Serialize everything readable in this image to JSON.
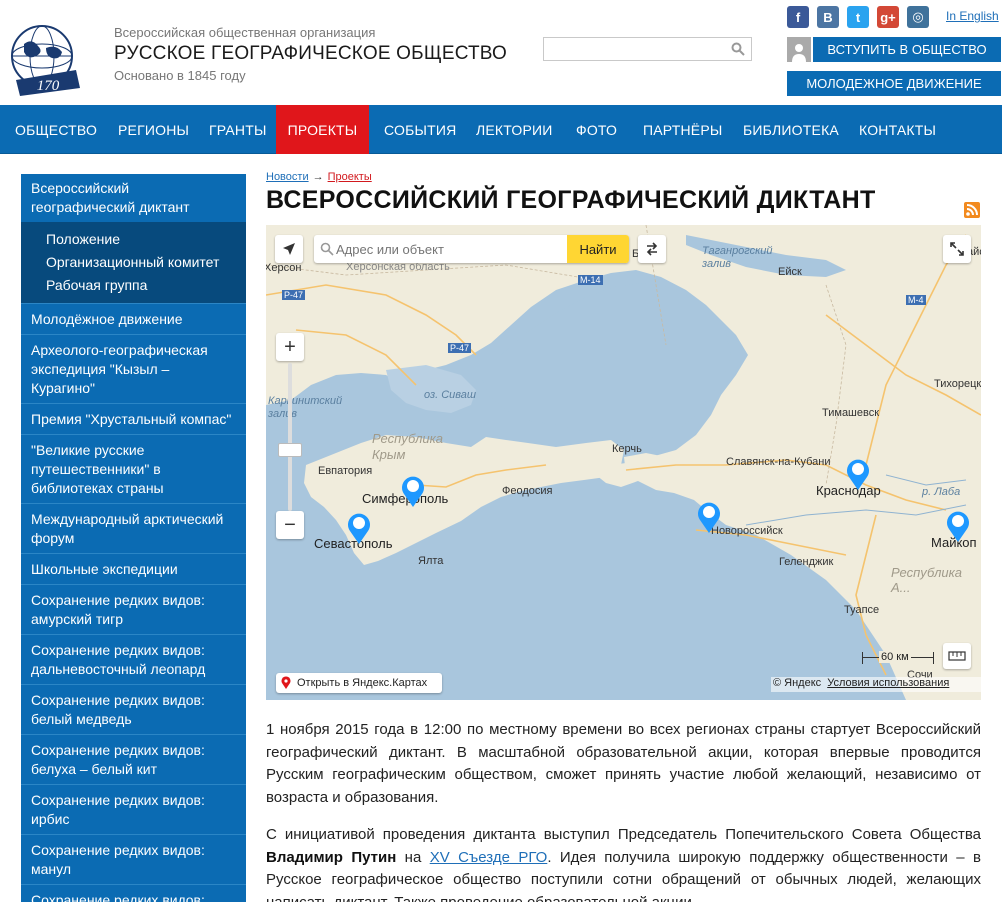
{
  "header": {
    "org_subtitle": "Всероссийская общественная организация",
    "org_title": "РУССКОЕ ГЕОГРАФИЧЕСКОЕ ОБЩЕСТВО",
    "org_founded": "Основано в 1845 году",
    "logo_text": "РУССКОЕ ГЕОГРАФИЧЕСКОЕ ОБЩЕСТВО",
    "logo_number": "170",
    "search_placeholder": "",
    "in_english": "In English",
    "join_button": "ВСТУПИТЬ В ОБЩЕСТВО",
    "youth_button": "МОЛОДЕЖНОЕ ДВИЖЕНИЕ",
    "socials": [
      {
        "name": "facebook",
        "glyph": "f",
        "color": "#3b5998"
      },
      {
        "name": "vkontakte",
        "glyph": "В",
        "color": "#4c75a3"
      },
      {
        "name": "twitter",
        "glyph": "t",
        "color": "#2aa3ef"
      },
      {
        "name": "google-plus",
        "glyph": "g+",
        "color": "#d34836"
      },
      {
        "name": "instagram",
        "glyph": "◎",
        "color": "#3f729b"
      }
    ]
  },
  "nav": {
    "items": [
      "ОБЩЕСТВО",
      "РЕГИОНЫ",
      "ГРАНТЫ",
      "ПРОЕКТЫ",
      "СОБЫТИЯ",
      "ЛЕКТОРИИ",
      "ФОТО",
      "ПАРТНЁРЫ",
      "БИБЛИОТЕКА",
      "КОНТАКТЫ"
    ],
    "active": "ПРОЕКТЫ"
  },
  "sidebar": {
    "top_item": "Всероссийский географический диктант",
    "sub_items": [
      "Положение",
      "Организационный комитет",
      "Рабочая группа"
    ],
    "items": [
      "Молодёжное движение",
      "Археолого-географическая экспедиция \"Кызыл – Курагино\"",
      "Премия \"Хрустальный компас\"",
      "\"Великие русские путешественники\" в библиотеках страны",
      "Международный арктический форум",
      "Школьные экспедиции",
      "Сохранение редких видов: амурский тигр",
      "Сохранение редких видов: дальневосточный леопард",
      "Сохранение редких видов: белый медведь",
      "Сохранение редких видов: белуха – белый кит",
      "Сохранение редких видов: ирбис",
      "Сохранение редких видов: манул",
      "Сохранение редких видов:"
    ]
  },
  "breadcrumb": {
    "home": "Новости",
    "separator": "→",
    "current": "Проекты"
  },
  "page_title": "ВСЕРОССИЙСКИЙ ГЕОГРАФИЧЕСКИЙ ДИКТАНТ",
  "map": {
    "search_placeholder": "Адрес или объект",
    "find_button": "Найти",
    "zoom_in": "+",
    "zoom_out": "−",
    "scale_label": "60 км",
    "open_in_yandex": "Открыть в Яндекс.Картах",
    "copyright": "© Яндекс",
    "terms": "Условия использования",
    "labels": {
      "kherson": "Херсон",
      "kherson_region": "Херсонская область",
      "r47a": "Р-47",
      "r47b": "Р-47",
      "m14": "М-14",
      "m4": "М-4",
      "taganrog_bay": "Таганрогский\nзалив",
      "yeysk": "Ейск",
      "berdyansk": "Бе...",
      "batay": "Батайс",
      "karkinit": "Каркинитский\nзалив",
      "sivash": "оз. Сиваш",
      "crimea": "Республика\nКрым",
      "evpatoria": "Евпатория",
      "simferopol": "Симферополь",
      "sevastopol": "Севастополь",
      "yalta": "Ялта",
      "feodosia": "Феодосия",
      "kerch": "Керчь",
      "timashevsk": "Тимашевск",
      "tikhoretsk": "Тихорецк",
      "slavyansk": "Славянск-на-Кубани",
      "krasnodar": "Краснодар",
      "novorossiysk": "Новороссийск",
      "gelendzhik": "Геленджик",
      "tuapse": "Туапсе",
      "sochi": "Сочи",
      "maykop": "Майкоп",
      "adygea": "Республика А...",
      "laba": "р. Лаба"
    }
  },
  "paragraphs": {
    "p1": "1 ноября 2015 года в 12:00 по местному времени во всех регионах страны стартует Всероссийский географический диктант. В масштабной образовательной акции, которая впервые проводится Русским географическим обществом, сможет принять участие любой желающий, независимо от возраста и образования.",
    "p2_a": "С инициативой проведения диктанта выступил Председатель Попечительского Совета Общества ",
    "p2_bold": "Владимир Путин",
    "p2_b": " на ",
    "p2_link": "XV Съезде РГО",
    "p2_c": ". Идея получила широкую поддержку общественности – в Русское географическое общество поступили сотни обращений от обычных людей, желающих написать диктант. Также проведение образовательной акции"
  }
}
